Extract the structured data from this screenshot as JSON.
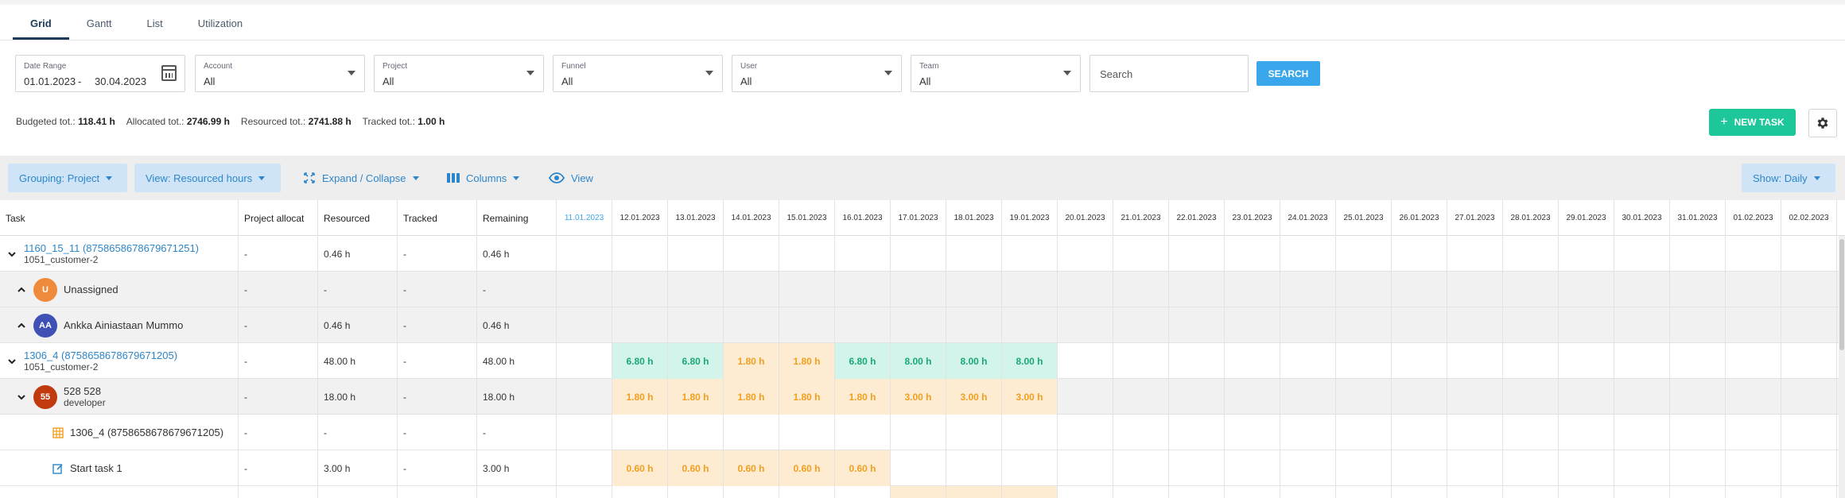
{
  "tabs": [
    "Grid",
    "Gantt",
    "List",
    "Utilization"
  ],
  "filters": {
    "date_range": {
      "label": "Date Range",
      "from": "01.01.2023",
      "sep": "-",
      "to": "30.04.2023"
    },
    "account": {
      "label": "Account",
      "value": "All"
    },
    "project": {
      "label": "Project",
      "value": "All"
    },
    "funnel": {
      "label": "Funnel",
      "value": "All"
    },
    "user": {
      "label": "User",
      "value": "All"
    },
    "team": {
      "label": "Team",
      "value": "All"
    },
    "search_placeholder": "Search",
    "search_button": "SEARCH"
  },
  "totals": {
    "budgeted_label": "Budgeted tot.:",
    "budgeted": "118.41 h",
    "allocated_label": "Allocated tot.:",
    "allocated": "2746.99 h",
    "resourced_label": "Resourced tot.:",
    "resourced": "2741.88 h",
    "tracked_label": "Tracked tot.:",
    "tracked": "1.00 h"
  },
  "new_task_label": "NEW TASK",
  "toolbar": {
    "grouping": "Grouping: Project",
    "view_hours": "View: Resourced hours",
    "expand": "Expand / Collapse",
    "columns": "Columns",
    "view": "View",
    "show": "Show: Daily"
  },
  "columns": {
    "task": "Task",
    "project_alloc": "Project allocat",
    "resourced": "Resourced",
    "tracked": "Tracked",
    "remaining": "Remaining"
  },
  "dates": [
    "11.01.2023",
    "12.01.2023",
    "13.01.2023",
    "14.01.2023",
    "15.01.2023",
    "16.01.2023",
    "17.01.2023",
    "18.01.2023",
    "19.01.2023",
    "20.01.2023",
    "21.01.2023",
    "22.01.2023",
    "23.01.2023",
    "24.01.2023",
    "25.01.2023",
    "26.01.2023",
    "27.01.2023",
    "28.01.2023",
    "29.01.2023",
    "30.01.2023",
    "31.01.2023",
    "01.02.2023",
    "02.02.2023"
  ],
  "rows": [
    {
      "kind": "project",
      "name": "1160_15_11 (8758658678679671251)",
      "sub": "1051_customer-2",
      "alloc": "-",
      "resourced": "0.46 h",
      "tracked": "-",
      "remaining": "0.46 h",
      "toggle": "down",
      "cells": []
    },
    {
      "kind": "person",
      "name": "Unassigned",
      "initials": "U",
      "avatar_color": "#ef8a3a",
      "alloc": "-",
      "resourced": "-",
      "tracked": "-",
      "remaining": "-",
      "toggle": "up",
      "cells": []
    },
    {
      "kind": "person",
      "name": "Ankka Ainiastaan Mummo",
      "initials": "AA",
      "avatar_color": "#3f51b5",
      "alloc": "-",
      "resourced": "0.46 h",
      "tracked": "-",
      "remaining": "0.46 h",
      "toggle": "up",
      "cells": []
    },
    {
      "kind": "project",
      "name": "1306_4 (8758658678679671205)",
      "sub": "1051_customer-2",
      "alloc": "-",
      "resourced": "48.00 h",
      "tracked": "-",
      "remaining": "48.00 h",
      "toggle": "down",
      "cells": [
        {
          "i": 1,
          "v": "6.80 h",
          "c": "green"
        },
        {
          "i": 2,
          "v": "6.80 h",
          "c": "green"
        },
        {
          "i": 3,
          "v": "1.80 h",
          "c": "orange"
        },
        {
          "i": 4,
          "v": "1.80 h",
          "c": "orange"
        },
        {
          "i": 5,
          "v": "6.80 h",
          "c": "green"
        },
        {
          "i": 6,
          "v": "8.00 h",
          "c": "green"
        },
        {
          "i": 7,
          "v": "8.00 h",
          "c": "green"
        },
        {
          "i": 8,
          "v": "8.00 h",
          "c": "green"
        }
      ]
    },
    {
      "kind": "person",
      "name": "528 528",
      "sub": "developer",
      "initials": "55",
      "avatar_color": "#c0390f",
      "alloc": "-",
      "resourced": "18.00 h",
      "tracked": "-",
      "remaining": "18.00 h",
      "toggle": "down",
      "cells": [
        {
          "i": 1,
          "v": "1.80 h",
          "c": "orange"
        },
        {
          "i": 2,
          "v": "1.80 h",
          "c": "orange"
        },
        {
          "i": 3,
          "v": "1.80 h",
          "c": "orange"
        },
        {
          "i": 4,
          "v": "1.80 h",
          "c": "orange"
        },
        {
          "i": 5,
          "v": "1.80 h",
          "c": "orange"
        },
        {
          "i": 6,
          "v": "3.00 h",
          "c": "orange"
        },
        {
          "i": 7,
          "v": "3.00 h",
          "c": "orange"
        },
        {
          "i": 8,
          "v": "3.00 h",
          "c": "orange"
        }
      ]
    },
    {
      "kind": "subproject",
      "name": "1306_4 (8758658678679671205)",
      "icon": "grid-icon",
      "alloc": "-",
      "resourced": "-",
      "tracked": "-",
      "remaining": "-",
      "cells": []
    },
    {
      "kind": "task",
      "name": "Start task 1",
      "icon": "edit-icon",
      "alloc": "-",
      "resourced": "3.00 h",
      "tracked": "-",
      "remaining": "3.00 h",
      "cells": [
        {
          "i": 1,
          "v": "0.60 h",
          "c": "orange"
        },
        {
          "i": 2,
          "v": "0.60 h",
          "c": "orange"
        },
        {
          "i": 3,
          "v": "0.60 h",
          "c": "orange"
        },
        {
          "i": 4,
          "v": "0.60 h",
          "c": "orange"
        },
        {
          "i": 5,
          "v": "0.60 h",
          "c": "orange"
        }
      ]
    },
    {
      "kind": "partial",
      "name": "",
      "alloc": "",
      "resourced": "",
      "tracked": "",
      "remaining": "",
      "cells": [
        {
          "i": 6,
          "v": "",
          "c": "orange"
        },
        {
          "i": 7,
          "v": "",
          "c": "orange"
        },
        {
          "i": 8,
          "v": "",
          "c": "orange"
        }
      ]
    }
  ]
}
